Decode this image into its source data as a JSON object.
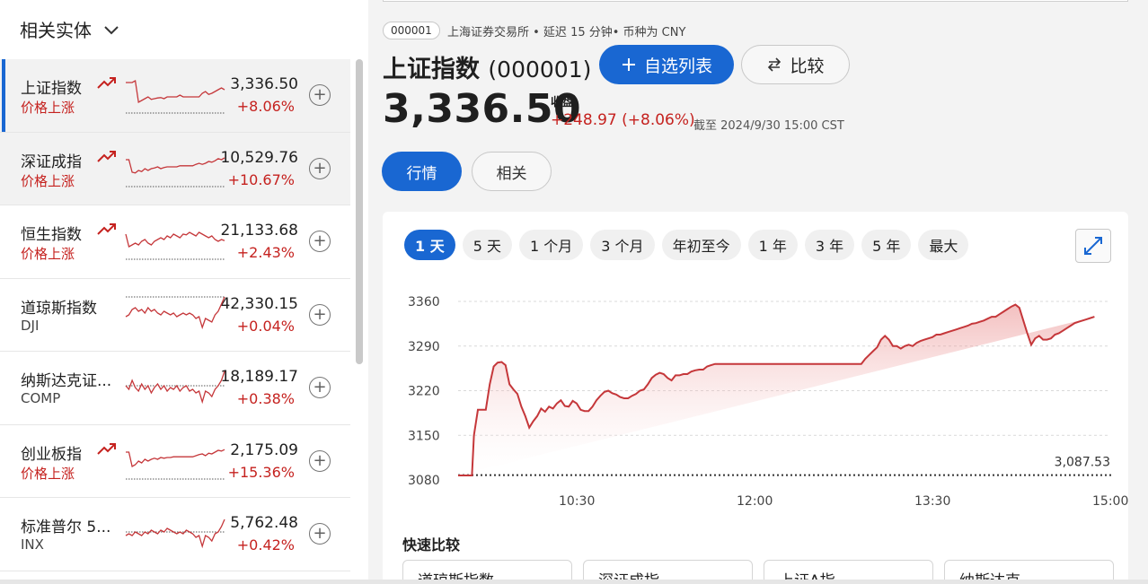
{
  "sidebar": {
    "header": "相关实体",
    "items": [
      {
        "name": "上证指数",
        "sub": "价格上涨",
        "sub_up": true,
        "trend": true,
        "price": "3,336.50",
        "change": "+8.06%",
        "spark": [
          0.15,
          0.15,
          0.15,
          0.1,
          0.7,
          0.65,
          0.6,
          0.55,
          0.62,
          0.6,
          0.58,
          0.57,
          0.6,
          0.55,
          0.55,
          0.55,
          0.55,
          0.5,
          0.55,
          0.55,
          0.55,
          0.55,
          0.55,
          0.55,
          0.45,
          0.4,
          0.48,
          0.45,
          0.4,
          0.35,
          0.3,
          0.35
        ],
        "spark_base": 0.15
      },
      {
        "name": "深证成指",
        "sub": "价格上涨",
        "sub_up": true,
        "trend": true,
        "price": "10,529.76",
        "change": "+10.67%",
        "spark": [
          0.25,
          0.25,
          0.6,
          0.62,
          0.55,
          0.58,
          0.5,
          0.55,
          0.5,
          0.48,
          0.45,
          0.5,
          0.47,
          0.45,
          0.45,
          0.45,
          0.45,
          0.42,
          0.42,
          0.42,
          0.42,
          0.42,
          0.38,
          0.35,
          0.38,
          0.35,
          0.3,
          0.32,
          0.28,
          0.22,
          0.25,
          0.2
        ],
        "spark_base": 0.25
      },
      {
        "name": "恒生指数",
        "sub": "价格上涨",
        "sub_up": true,
        "trend": true,
        "price": "21,133.68",
        "change": "+2.43%",
        "spark": [
          0.3,
          0.65,
          0.6,
          0.55,
          0.6,
          0.5,
          0.45,
          0.55,
          0.6,
          0.5,
          0.45,
          0.4,
          0.45,
          0.35,
          0.4,
          0.3,
          0.35,
          0.4,
          0.3,
          0.32,
          0.25,
          0.3,
          0.35,
          0.25,
          0.3,
          0.35,
          0.4,
          0.35,
          0.45,
          0.5,
          0.45,
          0.48
        ],
        "spark_base": 0.75
      },
      {
        "name": "道琼斯指数",
        "sub": "DJI",
        "sub_up": false,
        "trend": false,
        "price": "42,330.15",
        "change": "+0.04%",
        "spark": [
          0.55,
          0.5,
          0.35,
          0.3,
          0.4,
          0.35,
          0.45,
          0.3,
          0.4,
          0.35,
          0.45,
          0.5,
          0.4,
          0.45,
          0.5,
          0.45,
          0.55,
          0.5,
          0.45,
          0.5,
          0.45,
          0.5,
          0.6,
          0.55,
          0.85,
          0.6,
          0.65,
          0.7,
          0.5,
          0.4,
          0.2,
          0.0
        ],
        "spark_base": 0.0
      },
      {
        "name": "纳斯达克证...",
        "sub": "COMP",
        "sub_up": false,
        "trend": false,
        "price": "18,189.17",
        "change": "+0.38%",
        "spark": [
          0.45,
          0.55,
          0.3,
          0.5,
          0.6,
          0.4,
          0.55,
          0.45,
          0.65,
          0.5,
          0.4,
          0.55,
          0.45,
          0.6,
          0.5,
          0.55,
          0.45,
          0.6,
          0.5,
          0.45,
          0.6,
          0.55,
          0.65,
          0.6,
          0.9,
          0.6,
          0.65,
          0.75,
          0.55,
          0.45,
          0.3,
          0.05
        ],
        "spark_base": 0.45
      },
      {
        "name": "创业板指",
        "sub": "价格上涨",
        "sub_up": true,
        "trend": true,
        "price": "2,175.09",
        "change": "+15.36%",
        "spark": [
          0.25,
          0.25,
          0.65,
          0.6,
          0.5,
          0.55,
          0.45,
          0.5,
          0.45,
          0.42,
          0.45,
          0.4,
          0.42,
          0.4,
          0.4,
          0.38,
          0.38,
          0.38,
          0.38,
          0.38,
          0.38,
          0.38,
          0.35,
          0.32,
          0.3,
          0.35,
          0.28,
          0.3,
          0.25,
          0.2,
          0.22,
          0.18
        ],
        "spark_base": 0.25
      },
      {
        "name": "标准普尔 5...",
        "sub": "INX",
        "sub_up": false,
        "trend": false,
        "price": "5,762.48",
        "change": "+0.42%",
        "spark": [
          0.55,
          0.5,
          0.55,
          0.45,
          0.5,
          0.55,
          0.45,
          0.5,
          0.4,
          0.45,
          0.5,
          0.4,
          0.45,
          0.35,
          0.4,
          0.45,
          0.5,
          0.45,
          0.5,
          0.4,
          0.45,
          0.5,
          0.6,
          0.55,
          0.85,
          0.55,
          0.6,
          0.7,
          0.5,
          0.45,
          0.3,
          0.1
        ],
        "spark_base": 0.45
      }
    ]
  },
  "header": {
    "code_badge": "000001",
    "exchange_info": "上海证券交易所 • 延迟 15 分钟• 币种为 CNY",
    "name": "上证指数",
    "code": "(000001)",
    "watchlist_label": "自选列表",
    "compare_label": "比较",
    "price": "3,336.50",
    "close_label": "收盘",
    "change": "+248.97 (+8.06%)",
    "as_of": "截至 2024/9/30 15:00 CST"
  },
  "tabs": [
    "行情",
    "相关"
  ],
  "ranges": [
    "1 天",
    "5 天",
    "1 个月",
    "3 个月",
    "年初至今",
    "1 年",
    "3 年",
    "5 年",
    "最大"
  ],
  "chart_data": {
    "type": "area",
    "ylim": [
      3080,
      3360
    ],
    "yticks": [
      3360,
      3290,
      3220,
      3150,
      3080
    ],
    "xticks": [
      "10:30",
      "12:00",
      "13:30",
      "15:00"
    ],
    "xtick_pos": [
      60,
      150,
      240,
      330
    ],
    "xlim": [
      0,
      330
    ],
    "previous_close": 3087.53,
    "previous_close_label": "3,087.53",
    "x": [
      0,
      7,
      8,
      10,
      12,
      14,
      16,
      18,
      20,
      22,
      24,
      26,
      28,
      30,
      32,
      34,
      36,
      38,
      40,
      42,
      44,
      46,
      48,
      50,
      52,
      54,
      56,
      58,
      60,
      62,
      64,
      66,
      68,
      70,
      72,
      74,
      76,
      78,
      80,
      82,
      84,
      86,
      88,
      90,
      92,
      94,
      96,
      98,
      100,
      102,
      104,
      106,
      108,
      110,
      112,
      114,
      116,
      118,
      120,
      122,
      124,
      126,
      128,
      130,
      132,
      134,
      136,
      138,
      140,
      142,
      144,
      146,
      148,
      150,
      160,
      170,
      180,
      185,
      188,
      190,
      192,
      194,
      196,
      198,
      200,
      202,
      204,
      206,
      208,
      210,
      212,
      214,
      216,
      218,
      220,
      222,
      224,
      226,
      228,
      230,
      232,
      234,
      236,
      238,
      240,
      242,
      244,
      246,
      248,
      250,
      252,
      254,
      256,
      258,
      260,
      262,
      264,
      266,
      268,
      270,
      272,
      274,
      276,
      278,
      280,
      282,
      284,
      286,
      288,
      290,
      292,
      294,
      296,
      298,
      300,
      302,
      304,
      306,
      308,
      310,
      312,
      314,
      316,
      318,
      320,
      322,
      324,
      326,
      328,
      330
    ],
    "y": [
      3087,
      3087,
      3150,
      3190,
      3190,
      3190,
      3230,
      3258,
      3264,
      3265,
      3260,
      3230,
      3222,
      3215,
      3195,
      3180,
      3162,
      3172,
      3180,
      3192,
      3187,
      3195,
      3192,
      3200,
      3205,
      3196,
      3195,
      3204,
      3200,
      3190,
      3188,
      3188,
      3195,
      3205,
      3212,
      3218,
      3220,
      3216,
      3214,
      3210,
      3208,
      3208,
      3212,
      3215,
      3220,
      3222,
      3230,
      3240,
      3245,
      3248,
      3246,
      3240,
      3236,
      3244,
      3244,
      3246,
      3246,
      3250,
      3252,
      3253,
      3253,
      3258,
      3260,
      3262,
      3262,
      3262,
      3262,
      3262,
      3262,
      3262,
      3262,
      3262,
      3262,
      3262,
      3262,
      3262,
      3262,
      3262,
      3262,
      3262,
      3262,
      3262,
      3262,
      3262,
      3262,
      3262,
      3262,
      3270,
      3276,
      3282,
      3288,
      3300,
      3306,
      3300,
      3290,
      3290,
      3286,
      3290,
      3292,
      3290,
      3295,
      3298,
      3300,
      3302,
      3304,
      3308,
      3308,
      3310,
      3312,
      3314,
      3316,
      3318,
      3320,
      3322,
      3325,
      3326,
      3328,
      3330,
      3333,
      3336,
      3336,
      3340,
      3344,
      3348,
      3352,
      3355,
      3350,
      3330,
      3310,
      3292,
      3302,
      3306,
      3300,
      3300,
      3302,
      3308,
      3310,
      3314,
      3318,
      3322,
      3326,
      3328,
      3330,
      3332,
      3334,
      3336
    ]
  },
  "quick_compare": {
    "title": "快速比较",
    "items": [
      "道琼斯指数",
      "深证成指",
      "上证A指",
      "纳斯达克"
    ]
  },
  "colors": {
    "accent": "#1967d2",
    "down_red": "#c5221f",
    "line_red": "#c5373a"
  }
}
